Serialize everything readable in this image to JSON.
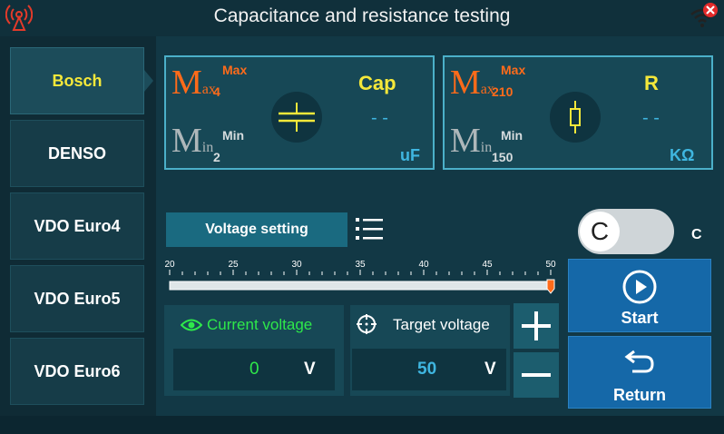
{
  "header": {
    "title": "Capacitance and resistance testing"
  },
  "sidebar": {
    "items": [
      {
        "label": "Bosch",
        "active": true
      },
      {
        "label": "DENSO"
      },
      {
        "label": "VDO Euro4"
      },
      {
        "label": "VDO Euro5"
      },
      {
        "label": "VDO Euro6"
      }
    ]
  },
  "cap_card": {
    "max_caption": "Max",
    "max_value": "4",
    "min_caption": "Min",
    "min_value": "2",
    "name": "Cap",
    "reading": "- -",
    "unit": "uF",
    "symbol_icon": "capacitor-icon"
  },
  "res_card": {
    "max_caption": "Max",
    "max_value": "210",
    "min_caption": "Min",
    "min_value": "150",
    "name": "R",
    "reading": "- -",
    "unit": "KΩ",
    "symbol_icon": "resistor-icon"
  },
  "controls": {
    "voltage_setting": "Voltage setting",
    "toggle_knob": "C",
    "toggle_label": "C"
  },
  "scale": {
    "ticks": [
      "20",
      "25",
      "30",
      "35",
      "40",
      "45",
      "50"
    ],
    "min": 20,
    "max": 50,
    "value": 50
  },
  "current_voltage": {
    "label": "Current voltage",
    "value": "0",
    "unit": "V"
  },
  "target_voltage": {
    "label": "Target voltage",
    "value": "50",
    "unit": "V"
  },
  "buttons": {
    "start": "Start",
    "return": "Return"
  },
  "colors": {
    "accent_yellow": "#f5e83a",
    "accent_orange": "#ff6b1a",
    "accent_green": "#2ee84a",
    "accent_cyan": "#3fb6e0"
  }
}
